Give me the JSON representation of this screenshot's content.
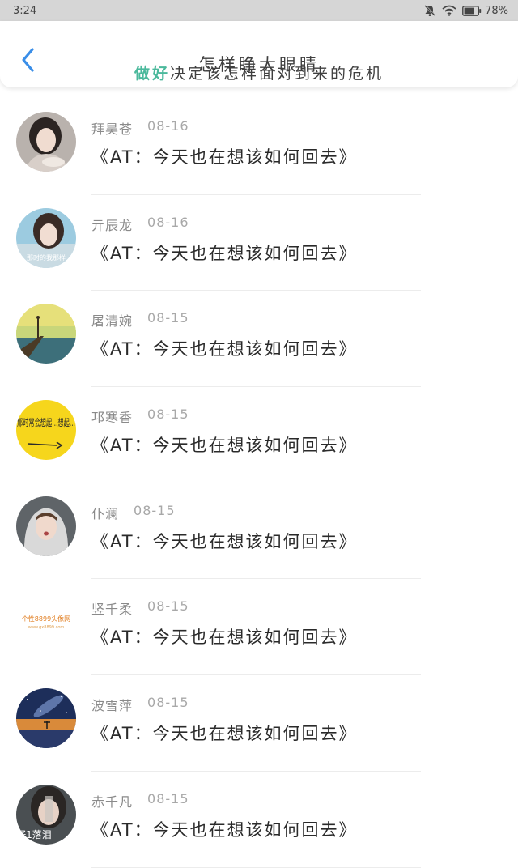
{
  "status_bar": {
    "time": "3:24",
    "battery": "78%",
    "icons": [
      "mute-bell-icon",
      "wifi-icon",
      "battery-icon"
    ]
  },
  "header": {
    "title": "怎样睁大眼睛",
    "subtitle_accent": "做好",
    "subtitle_rest": "决定该怎样面对到来的危机",
    "back_icon": "chevron-left-icon"
  },
  "colors": {
    "back": "#3a8ee8",
    "accent": "#4bb99c",
    "status_bar": "#d6d6d6"
  },
  "items": [
    {
      "name": "拜昊苍",
      "date": "08-16",
      "message": "《AT：今天也在想该如何回去》",
      "avatar": "girl-portrait"
    },
    {
      "name": "亓辰龙",
      "date": "08-16",
      "message": "《AT：今天也在想该如何回去》",
      "avatar": "girl-selfie"
    },
    {
      "name": "屠清婉",
      "date": "08-15",
      "message": "《AT：今天也在想该如何回去》",
      "avatar": "pier-sunset"
    },
    {
      "name": "邛寒香",
      "date": "08-15",
      "message": "《AT：今天也在想该如何回去》",
      "avatar": "yellow-text"
    },
    {
      "name": "仆澜",
      "date": "08-15",
      "message": "《AT：今天也在想该如何回去》",
      "avatar": "girl-hoodie"
    },
    {
      "name": "竖千柔",
      "date": "08-15",
      "message": "《AT：今天也在想该如何回去》",
      "avatar": "watermark-logo"
    },
    {
      "name": "波雪萍",
      "date": "08-15",
      "message": "《AT：今天也在想该如何回去》",
      "avatar": "galaxy-night"
    },
    {
      "name": "赤千凡",
      "date": "08-15",
      "message": "《AT：今天也在想该如何回去》",
      "avatar": "girl-crying"
    }
  ],
  "avatar_text": {
    "girl-selfie": "那时的我那样",
    "yellow-text": "那时常会想起…想起…",
    "watermark-logo": "个性8899头像网",
    "watermark-url": "www.gx8899.com",
    "girl-crying": "好1落泪"
  }
}
